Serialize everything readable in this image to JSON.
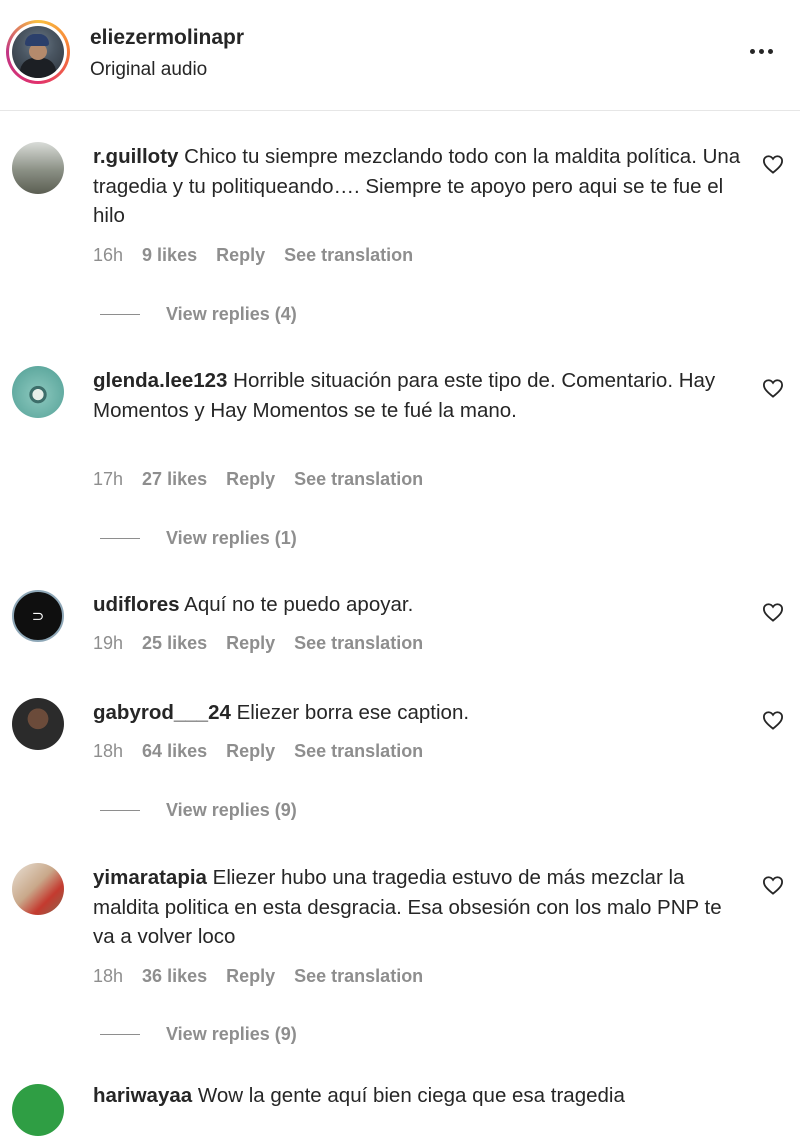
{
  "header": {
    "username": "eliezermolinapr",
    "subtitle": "Original audio"
  },
  "comments": [
    {
      "username": "r.guilloty",
      "text": "Chico tu siempre mezclando todo con la maldita política. Una tragedia y tu politiqueando…. Siempre te apoyo pero aqui se te fue el hilo",
      "time": "16h",
      "likes": "9 likes",
      "reply": "Reply",
      "see_translation": "See translation",
      "view_replies": "View replies (4)"
    },
    {
      "username": "glenda.lee123",
      "text": "Horrible situación para este tipo de. Comentario. Hay Momentos y Hay Momentos se te fué la mano.",
      "time": "17h",
      "likes": "27 likes",
      "reply": "Reply",
      "see_translation": "See translation",
      "view_replies": "View replies (1)"
    },
    {
      "username": "udiflores",
      "text": "Aquí no te puedo apoyar.",
      "time": "19h",
      "likes": "25 likes",
      "reply": "Reply",
      "see_translation": "See translation"
    },
    {
      "username": "gabyrod___24",
      "text": "Eliezer borra ese caption.",
      "time": "18h",
      "likes": "64 likes",
      "reply": "Reply",
      "see_translation": "See translation",
      "view_replies": "View replies (9)"
    },
    {
      "username": "yimaratapia",
      "text": "Eliezer hubo una tragedia estuvo de más mezclar la maldita politica en esta desgracia. Esa obsesión con los malo PNP te va a volver loco",
      "time": "18h",
      "likes": "36 likes",
      "reply": "Reply",
      "see_translation": "See translation",
      "view_replies": "View replies (9)"
    },
    {
      "username": "hariwayaa",
      "text": "Wow la gente aquí bien ciega que esa tragedia"
    }
  ],
  "icons": {
    "more": "more-options-icon",
    "like": "heart-outline-icon"
  },
  "colors": {
    "text": "#262626",
    "muted": "#8e8e8e",
    "divider": "#e6e6e6"
  }
}
